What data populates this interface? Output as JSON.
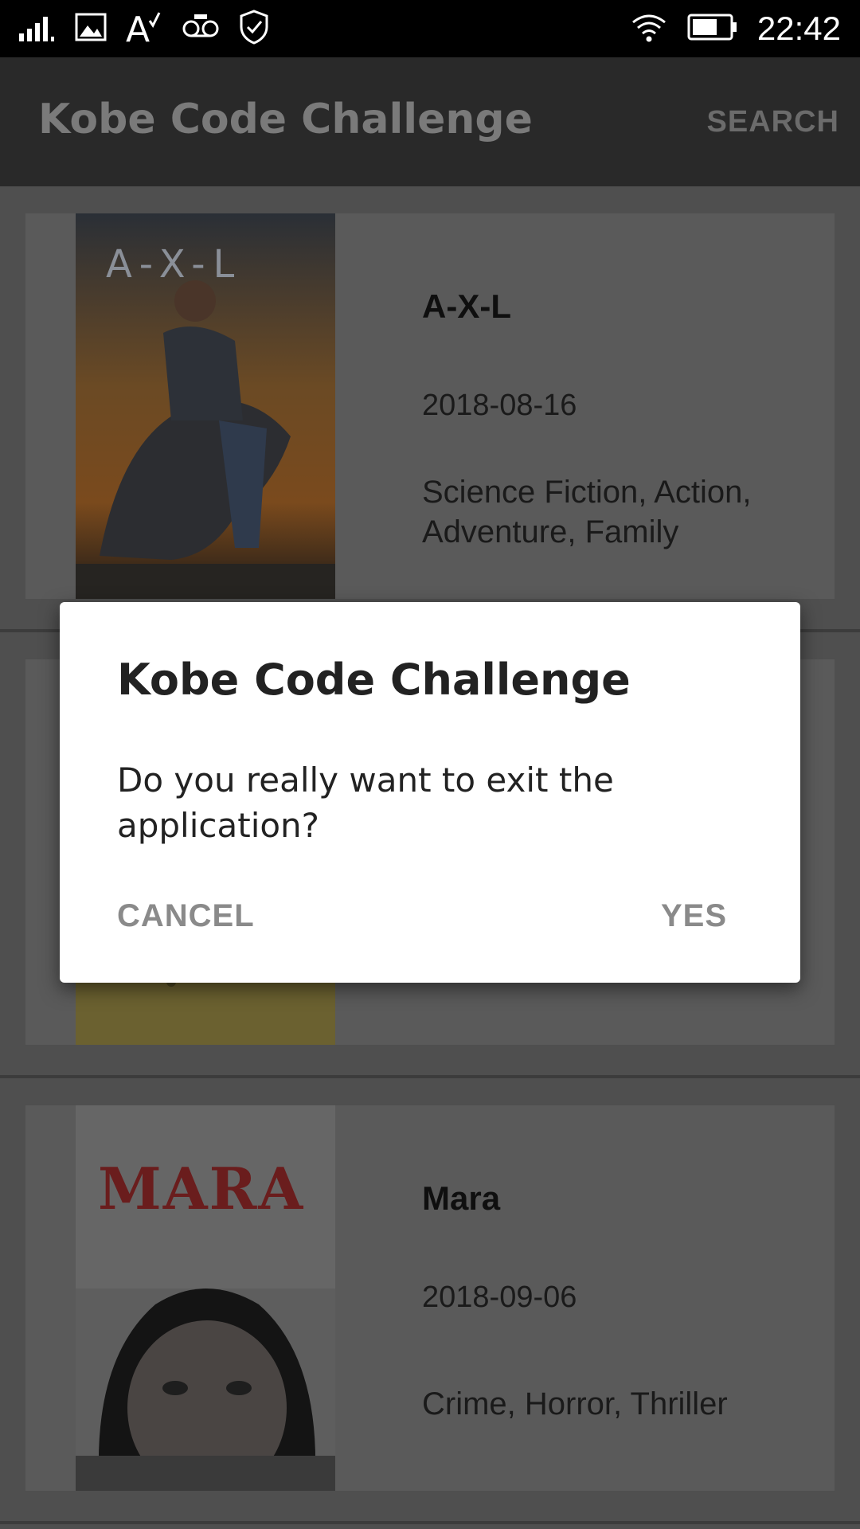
{
  "status_bar": {
    "time": "22:42",
    "icons": [
      "signal-icon",
      "image-icon",
      "spellcheck-icon",
      "voicemail-icon",
      "shield-check-icon",
      "wifi-icon",
      "battery-icon"
    ]
  },
  "app_bar": {
    "title": "Kobe Code Challenge",
    "action_label": "SEARCH"
  },
  "movies": [
    {
      "title": "A-X-L",
      "date": "2018-08-16",
      "genres": "Science Fiction, Action, Adventure, Family",
      "poster_text": "A-X-L"
    },
    {
      "title": "",
      "date": "",
      "genres": ""
    },
    {
      "title": "Mara",
      "date": "2018-09-06",
      "genres": "Crime, Horror, Thriller",
      "poster_text": "MARA"
    }
  ],
  "dialog": {
    "title": "Kobe Code Challenge",
    "message": "Do you really want to exit the application?",
    "cancel_label": "CANCEL",
    "confirm_label": "YES"
  },
  "colors": {
    "status_bar_bg": "#000000",
    "app_bar_bg": "#292929",
    "scrim_list_bg": "#4f4f4f",
    "dialog_bg": "#ffffff",
    "dialog_button": "#8a8a8a"
  }
}
